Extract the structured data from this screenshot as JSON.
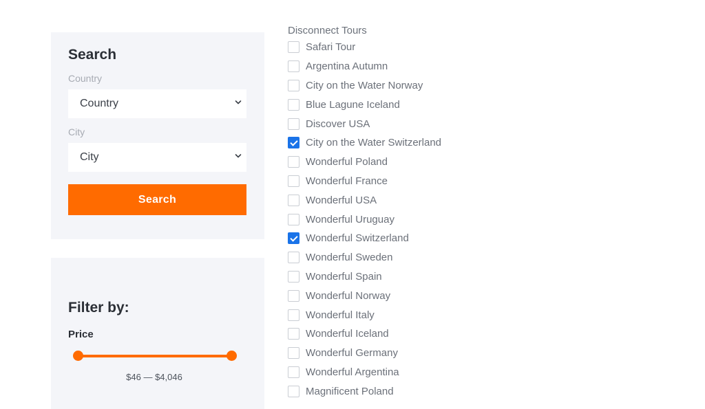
{
  "search": {
    "title": "Search",
    "country": {
      "label": "Country",
      "value": "Country"
    },
    "city": {
      "label": "City",
      "value": "City"
    },
    "button_label": "Search"
  },
  "filter": {
    "title": "Filter by:",
    "price": {
      "label": "Price",
      "range_text": "$46 — $4,046",
      "min": 46,
      "max": 4046
    }
  },
  "tours": {
    "heading": "Disconnect Tours",
    "items": [
      {
        "label": "Safari Tour",
        "checked": false
      },
      {
        "label": "Argentina Autumn",
        "checked": false
      },
      {
        "label": "City on the Water Norway",
        "checked": false
      },
      {
        "label": "Blue Lagune Iceland",
        "checked": false
      },
      {
        "label": "Discover USA",
        "checked": false
      },
      {
        "label": "City on the Water Switzerland",
        "checked": true
      },
      {
        "label": "Wonderful Poland",
        "checked": false
      },
      {
        "label": "Wonderful France",
        "checked": false
      },
      {
        "label": "Wonderful USA",
        "checked": false
      },
      {
        "label": "Wonderful Uruguay",
        "checked": false
      },
      {
        "label": "Wonderful Switzerland",
        "checked": true
      },
      {
        "label": "Wonderful Sweden",
        "checked": false
      },
      {
        "label": "Wonderful Spain",
        "checked": false
      },
      {
        "label": "Wonderful Norway",
        "checked": false
      },
      {
        "label": "Wonderful Italy",
        "checked": false
      },
      {
        "label": "Wonderful Iceland",
        "checked": false
      },
      {
        "label": "Wonderful Germany",
        "checked": false
      },
      {
        "label": "Wonderful Argentina",
        "checked": false
      },
      {
        "label": "Magnificent Poland",
        "checked": false
      }
    ]
  },
  "colors": {
    "accent": "#ff6b00",
    "checkbox_checked": "#1a73e8",
    "panel_bg": "#f4f5f9"
  },
  "icons": {
    "select_arrow": "chevron-down-icon",
    "slider_handle": "slider-handle-icon",
    "checkmark": "checkmark-icon"
  }
}
